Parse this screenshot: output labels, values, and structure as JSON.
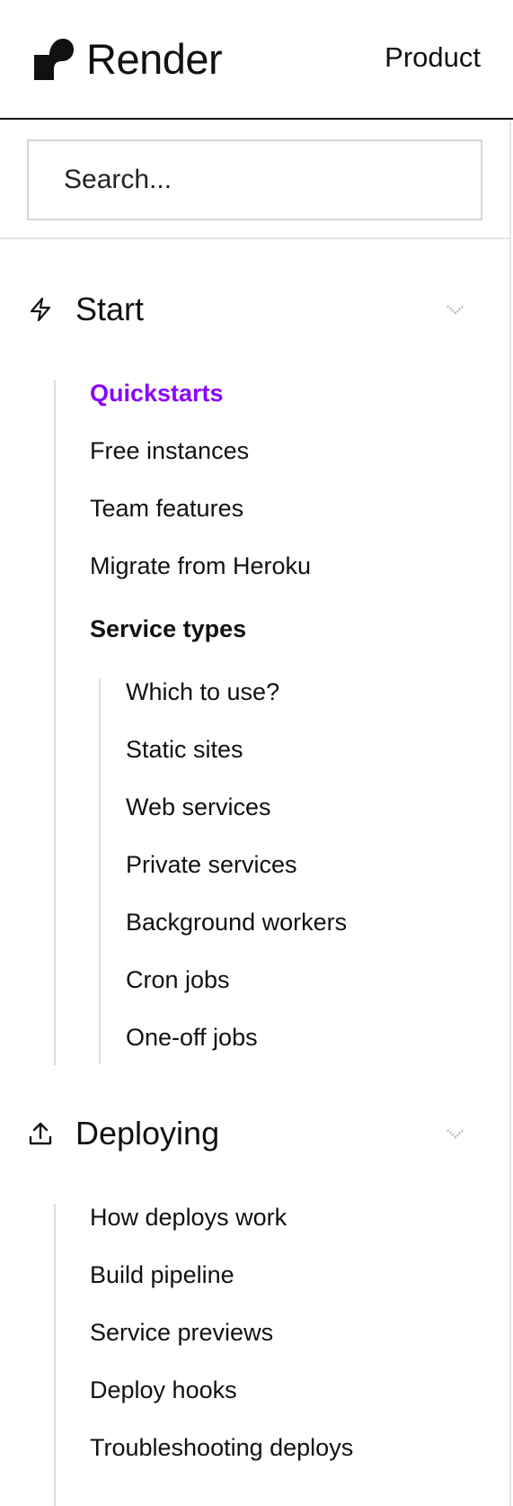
{
  "header": {
    "brand": "Render",
    "product_link": "Product"
  },
  "search": {
    "placeholder": "Search..."
  },
  "sections": [
    {
      "title": "Start",
      "icon": "lightning-icon",
      "items": [
        {
          "label": "Quickstarts",
          "state": "active"
        },
        {
          "label": "Free instances"
        },
        {
          "label": "Team features"
        },
        {
          "label": "Migrate from Heroku"
        },
        {
          "label": "Service types",
          "state": "group"
        },
        {
          "label": "Which to use?"
        },
        {
          "label": "Static sites"
        },
        {
          "label": "Web services"
        },
        {
          "label": "Private services"
        },
        {
          "label": "Background workers"
        },
        {
          "label": "Cron jobs"
        },
        {
          "label": "One-off jobs"
        }
      ]
    },
    {
      "title": "Deploying",
      "icon": "upload-icon",
      "items": [
        {
          "label": "How deploys work"
        },
        {
          "label": "Build pipeline"
        },
        {
          "label": "Service previews"
        },
        {
          "label": "Deploy hooks"
        },
        {
          "label": "Troubleshooting deploys"
        }
      ]
    }
  ],
  "colors": {
    "accent": "#8a05ff",
    "text": "#111111",
    "border": "#e4e4e4"
  }
}
